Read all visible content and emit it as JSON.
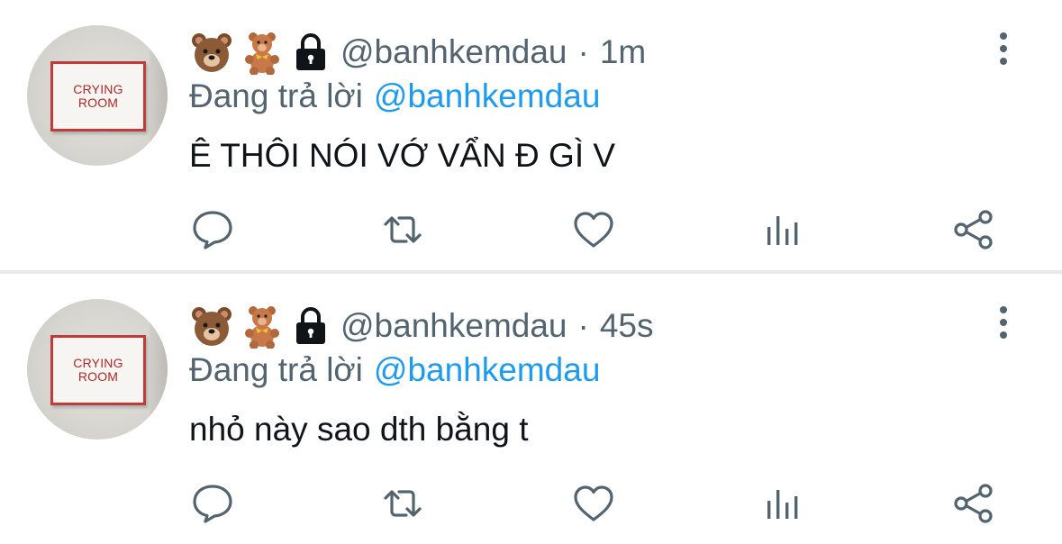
{
  "tweets": [
    {
      "avatar_sign": [
        "CRYING",
        "ROOM"
      ],
      "emojis": [
        "bear-face-icon",
        "teddy-bear-icon",
        "lock-icon"
      ],
      "handle": "@banhkemdau",
      "separator": "·",
      "time": "1m",
      "replying_label": "Đang trả lời",
      "replying_to": "@banhkemdau",
      "text": "Ê THÔI NÓI VỚ VẨN Đ GÌ V",
      "actions": [
        "reply-icon",
        "retweet-icon",
        "like-icon",
        "analytics-icon",
        "share-icon"
      ]
    },
    {
      "avatar_sign": [
        "CRYING",
        "ROOM"
      ],
      "emojis": [
        "bear-face-icon",
        "teddy-bear-icon",
        "lock-icon"
      ],
      "handle": "@banhkemdau",
      "separator": "·",
      "time": "45s",
      "replying_label": "Đang trả lời",
      "replying_to": "@banhkemdau",
      "text": "nhỏ này sao dth bằng t",
      "actions": [
        "reply-icon",
        "retweet-icon",
        "like-icon",
        "analytics-icon",
        "share-icon"
      ]
    }
  ],
  "colors": {
    "text": "#0f1419",
    "secondary": "#536471",
    "mention": "#1d9bf0",
    "divider": "#e7e9eb"
  }
}
